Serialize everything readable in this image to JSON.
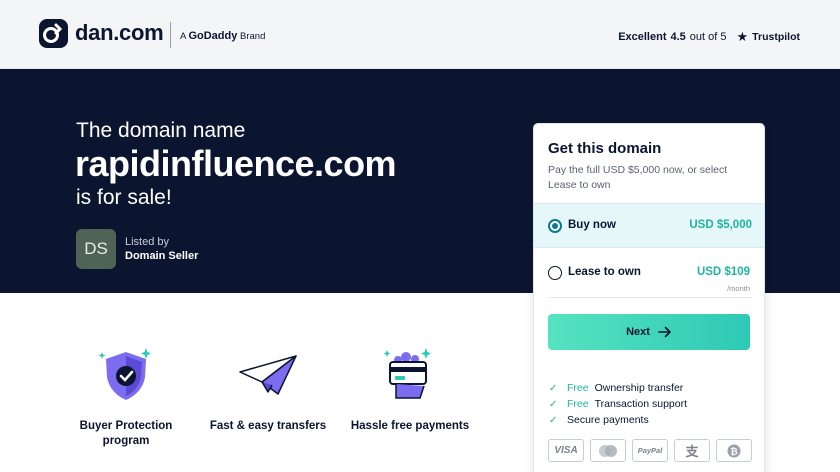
{
  "header": {
    "logo_text": "dan.com",
    "brand_prefix": "A",
    "brand_name": "GoDaddy",
    "brand_suffix": "Brand",
    "rating_label": "Excellent",
    "rating_score": "4.5",
    "rating_outof": "out of 5",
    "trustpilot": "Trustpilot"
  },
  "hero": {
    "line1": "The domain name",
    "domain": "rapidinfluence.com",
    "line3": "is for sale!",
    "avatar_initials": "DS",
    "listed_by": "Listed by",
    "seller": "Domain Seller"
  },
  "card": {
    "title": "Get this domain",
    "subtitle": "Pay the full USD $5,000 now, or select Lease to own",
    "option_buy_label": "Buy now",
    "option_buy_price": "USD $5,000",
    "option_buy_selected": true,
    "option_lease_label": "Lease to own",
    "option_lease_price": "USD $109",
    "option_lease_period": "/month",
    "next_label": "Next",
    "features": [
      {
        "free": "Free",
        "text": "Ownership transfer"
      },
      {
        "free": "Free",
        "text": "Transaction support"
      },
      {
        "free": "",
        "text": "Secure payments"
      }
    ],
    "payments": [
      "VISA",
      "mastercard",
      "PayPal",
      "alipay",
      "bitcoin"
    ]
  },
  "features": [
    {
      "label": "Buyer Protection program",
      "icon": "shield-check-icon"
    },
    {
      "label": "Fast & easy transfers",
      "icon": "paper-plane-icon"
    },
    {
      "label": "Hassle free payments",
      "icon": "card-hand-icon"
    }
  ],
  "colors": {
    "navy": "#0b1530",
    "accent": "#1fb59b",
    "button": "#3fd6bb"
  }
}
